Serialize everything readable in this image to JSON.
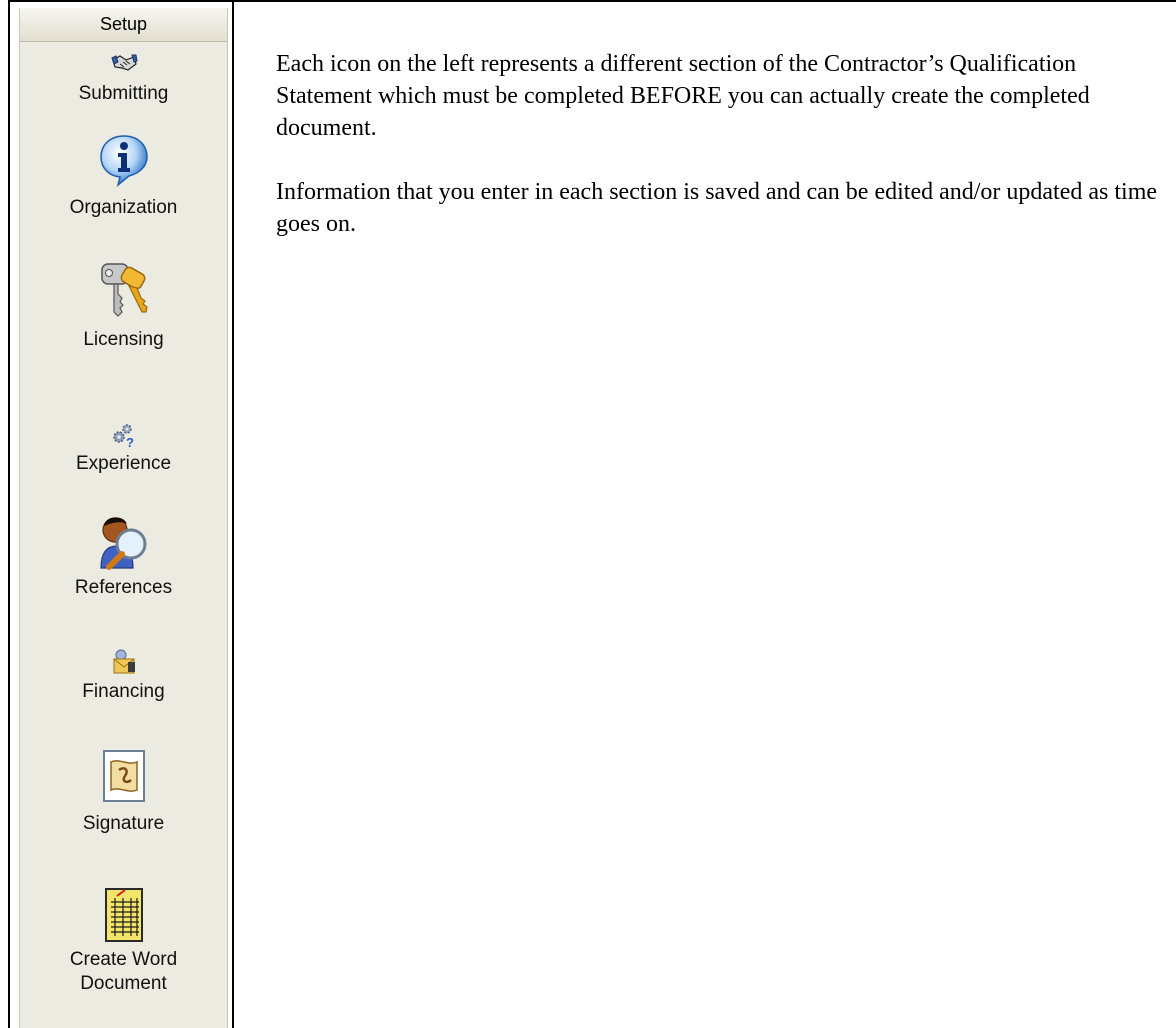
{
  "sidebar": {
    "header": "Setup",
    "items": [
      {
        "label": "Submitting",
        "icon": "handshake-icon"
      },
      {
        "label": "Organization",
        "icon": "info-icon"
      },
      {
        "label": "Licensing",
        "icon": "keys-icon"
      },
      {
        "label": "Experience",
        "icon": "gears-question-icon"
      },
      {
        "label": "References",
        "icon": "person-magnifier-icon"
      },
      {
        "label": "Financing",
        "icon": "money-envelope-icon"
      },
      {
        "label": "Signature",
        "icon": "scroll-document-icon"
      },
      {
        "label": "Create Word\nDocument",
        "icon": "spreadsheet-icon"
      }
    ]
  },
  "content": {
    "paragraphs": [
      "Each icon on the left represents a different section of the Contractor’s Qualification Statement which must be completed BEFORE you can actually create the completed document.",
      "Information that you enter in each section is saved and can be edited and/or updated as time goes on."
    ]
  }
}
